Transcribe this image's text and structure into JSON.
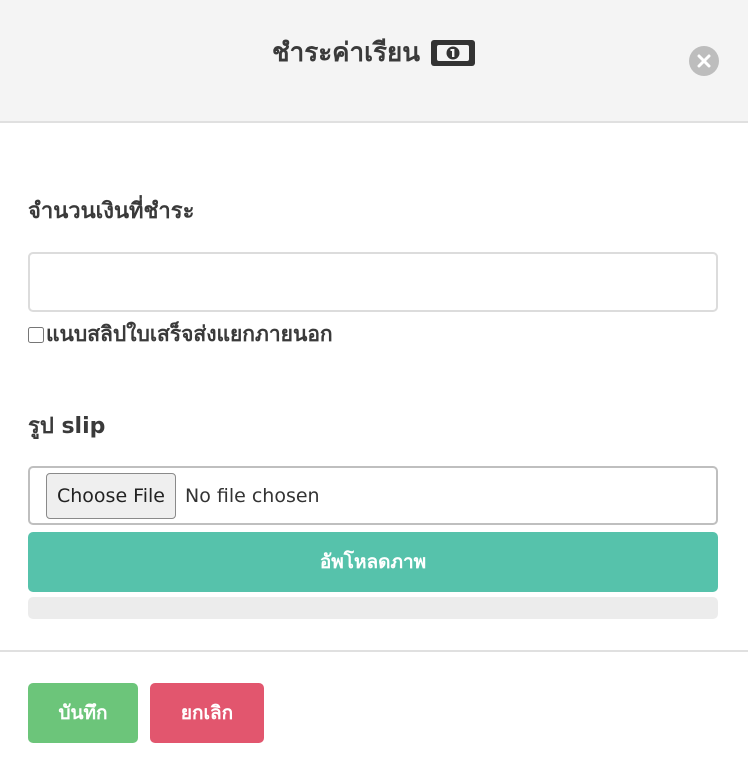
{
  "header": {
    "title": "ชำระค่าเรียน",
    "title_icon": "money-bill-icon",
    "close_icon": "close-icon"
  },
  "form": {
    "amount_label": "จำนวนเงินที่ชำระ",
    "amount_value": "",
    "separate_receipt_label": "แนบสลิปใบเสร็จส่งแยกภายนอก",
    "separate_receipt_checked": false,
    "slip_label": "รูป slip",
    "choose_file_label": "Choose File",
    "no_file_text": "No file chosen",
    "upload_label": "อัพโหลดภาพ",
    "upload_progress": 0
  },
  "footer": {
    "save_label": "บันทึก",
    "cancel_label": "ยกเลิก"
  },
  "colors": {
    "accent_teal": "#56c2ab",
    "save_green": "#6cc57a",
    "cancel_red": "#e2566e"
  }
}
